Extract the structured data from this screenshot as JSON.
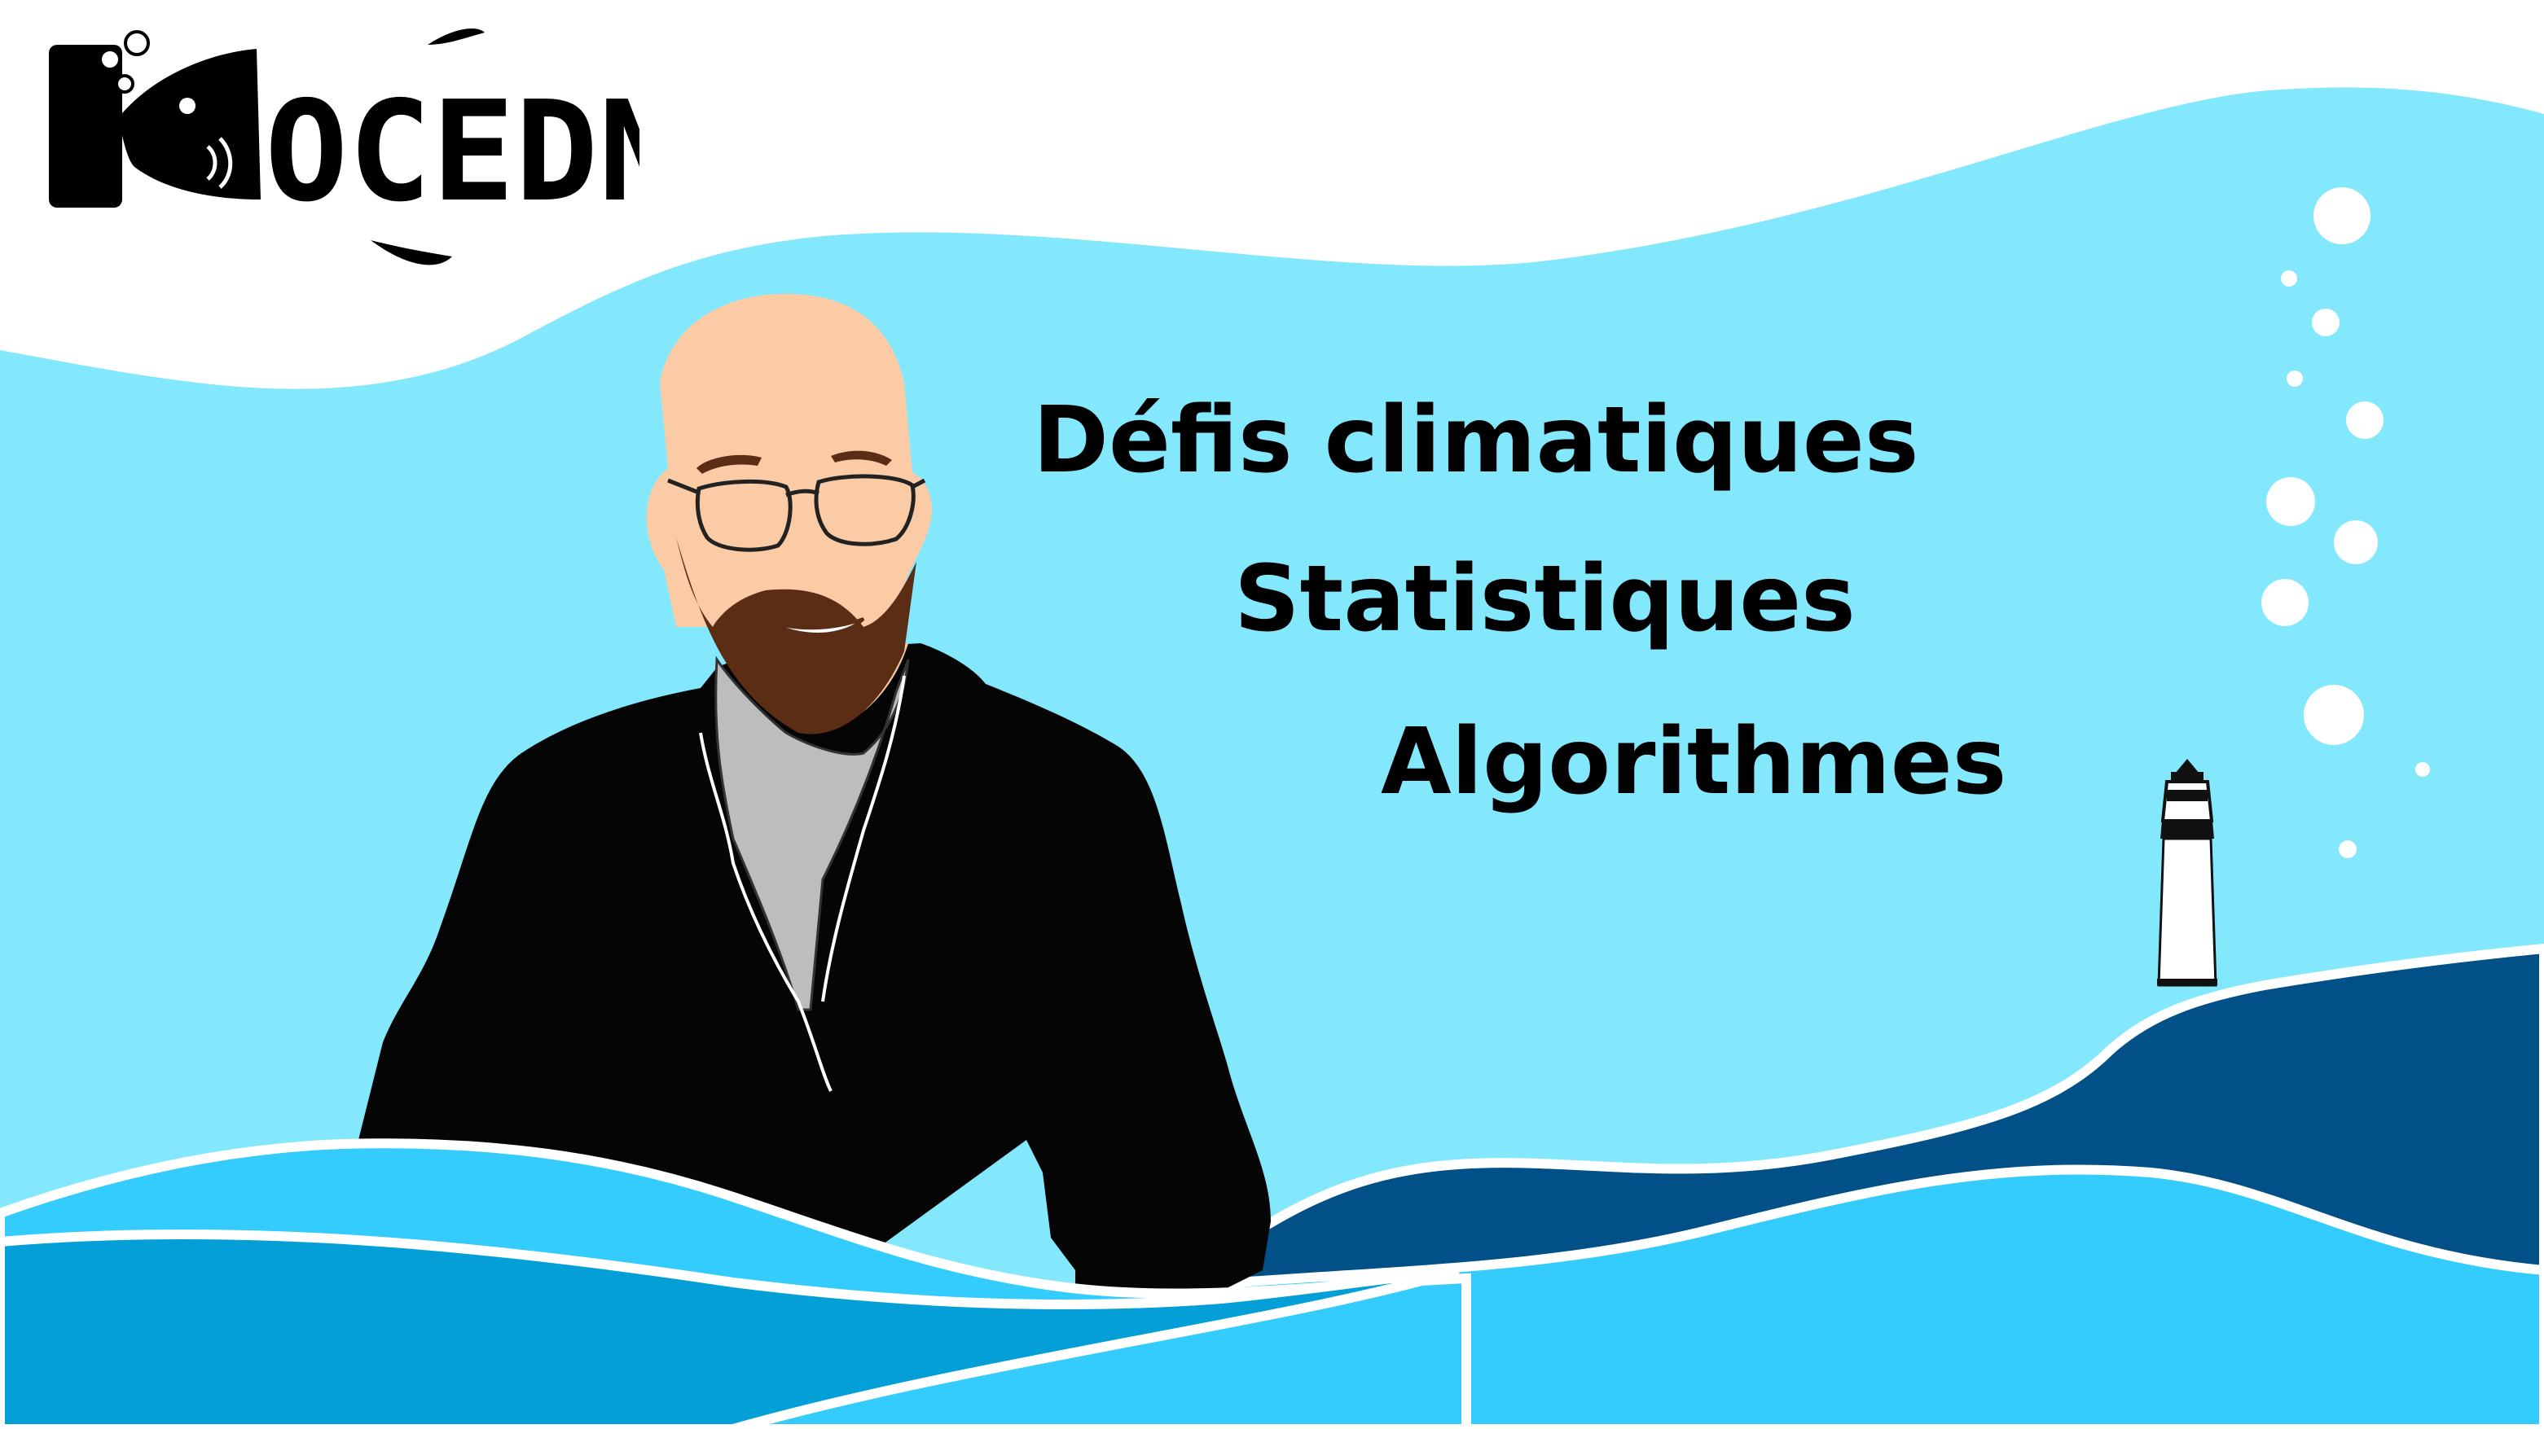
{
  "logo": {
    "text": "OCEDNA'K",
    "icon": "fish-camera-logo"
  },
  "headline": {
    "lines": [
      "Défis climatiques",
      "Statistiques",
      "Algorithmes"
    ]
  },
  "illustration": {
    "person": "bald-man-with-glasses-and-beard-avatar",
    "lighthouse": "lighthouse-icon",
    "bubbles": "bubbles-decoration",
    "waves": "ocean-waves-background"
  },
  "colors": {
    "sky": "#ffffff",
    "water_light": "#84e8fd",
    "water_mid": "#33ccfc",
    "water_deep": "#039fd6",
    "water_navy": "#015087",
    "jacket": "#050505",
    "skin": "#fbcba5",
    "beard": "#5a2d14"
  }
}
